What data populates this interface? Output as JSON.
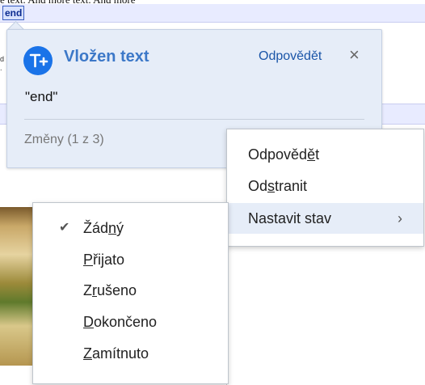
{
  "document": {
    "top_text": "e text. And more text. And more",
    "selected_token": "end",
    "margin_fragments": [
      "d r",
      "."
    ]
  },
  "card": {
    "title": "Vložen text",
    "reply_label": "Odpovědět",
    "close_glyph": "×",
    "quoted_text": "\"end\"",
    "footer": "Změny (1 z 3)"
  },
  "context_menu": {
    "items": [
      {
        "label_pre": "Odpověd",
        "label_key": "ě",
        "label_post": "t"
      },
      {
        "label_pre": "Od",
        "label_key": "s",
        "label_post": "tranit"
      },
      {
        "label_pre": "Nastavit stav",
        "label_key": "",
        "label_post": ""
      }
    ],
    "submenu_arrow": "›"
  },
  "status_menu": {
    "check_glyph": "✔",
    "items": [
      {
        "label_pre": "Žád",
        "label_key": "n",
        "label_post": "ý",
        "checked": true
      },
      {
        "label_pre": "",
        "label_key": "P",
        "label_post": "řijato",
        "checked": false
      },
      {
        "label_pre": "Z",
        "label_key": "r",
        "label_post": "ušeno",
        "checked": false
      },
      {
        "label_pre": "",
        "label_key": "D",
        "label_post": "okončeno",
        "checked": false
      },
      {
        "label_pre": "",
        "label_key": "Z",
        "label_post": "amítnuto",
        "checked": false
      }
    ]
  },
  "colors": {
    "accent": "#1a73e8",
    "card_bg": "#e6edf8",
    "title": "#3c78c8"
  }
}
